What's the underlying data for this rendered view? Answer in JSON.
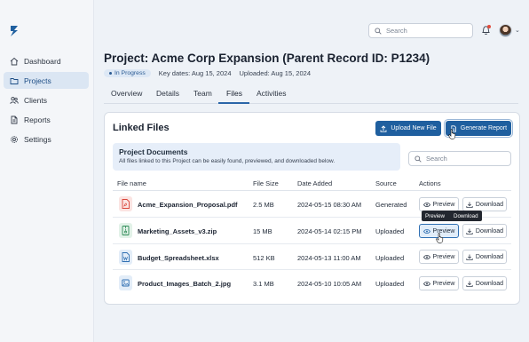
{
  "sidebar": {
    "items": [
      {
        "label": "Dashboard",
        "icon": "home-icon"
      },
      {
        "label": "Projects",
        "icon": "folder-icon",
        "active": true
      },
      {
        "label": "Clients",
        "icon": "users-icon"
      },
      {
        "label": "Reports",
        "icon": "document-icon"
      },
      {
        "label": "Settings",
        "icon": "gear-icon"
      }
    ]
  },
  "topbar": {
    "search_placeholder": "Search",
    "avatar_caret": "⌄"
  },
  "project": {
    "title": "Project: Acme Corp Expansion (Parent Record ID: P1234)",
    "status": "In Progress",
    "key_dates": "Key dates: Aug 15, 2024",
    "uploaded": "Uploaded: Aug 15, 2024"
  },
  "tabs": [
    {
      "label": "Overview"
    },
    {
      "label": "Details"
    },
    {
      "label": "Team"
    },
    {
      "label": "Files",
      "active": true
    },
    {
      "label": "Activities"
    }
  ],
  "card": {
    "title": "Linked Files",
    "upload_label": "Upload New File",
    "report_label": "Generate Report",
    "info_title": "Project Documents",
    "info_desc": "All files linked to this Project can be easily found, previewed, and downloaded below.",
    "search_placeholder": "Search"
  },
  "table": {
    "headers": [
      "File name",
      "File Size",
      "Date Added",
      "Source",
      "Actions"
    ],
    "rows": [
      {
        "name": "Acme_Expansion_Proposal.pdf",
        "size": "2.5 MB",
        "date": "2024-05-15 08:30 AM",
        "source": "Generated",
        "icon": "pdf-icon",
        "color": "#d9453a",
        "bg": "#fbe4e2"
      },
      {
        "name": "Marketing_Assets_v3.zip",
        "size": "15 MB",
        "date": "2024-05-14 02:15 PM",
        "source": "Uploaded",
        "icon": "zip-icon",
        "color": "#2e8b57",
        "bg": "#e2f2e8"
      },
      {
        "name": "Budget_Spreadsheet.xlsx",
        "size": "512 KB",
        "date": "2024-05-13 11:00 AM",
        "source": "Uploaded",
        "icon": "word-icon",
        "color": "#2f6fb2",
        "bg": "#e3edf8"
      },
      {
        "name": "Product_Images_Batch_2.jpg",
        "size": "3.1 MB",
        "date": "2024-05-10 10:05 AM",
        "source": "Uploaded",
        "icon": "image-icon",
        "color": "#2f6fb2",
        "bg": "#e3edf8"
      }
    ],
    "preview_label": "Preview",
    "download_label": "Download"
  },
  "tooltip": {
    "preview": "Preview",
    "download": "Download"
  },
  "colors": {
    "accent": "#1f5f9f",
    "active_nav_bg": "#dbe6f3",
    "badge_bg": "#dde8f5"
  }
}
